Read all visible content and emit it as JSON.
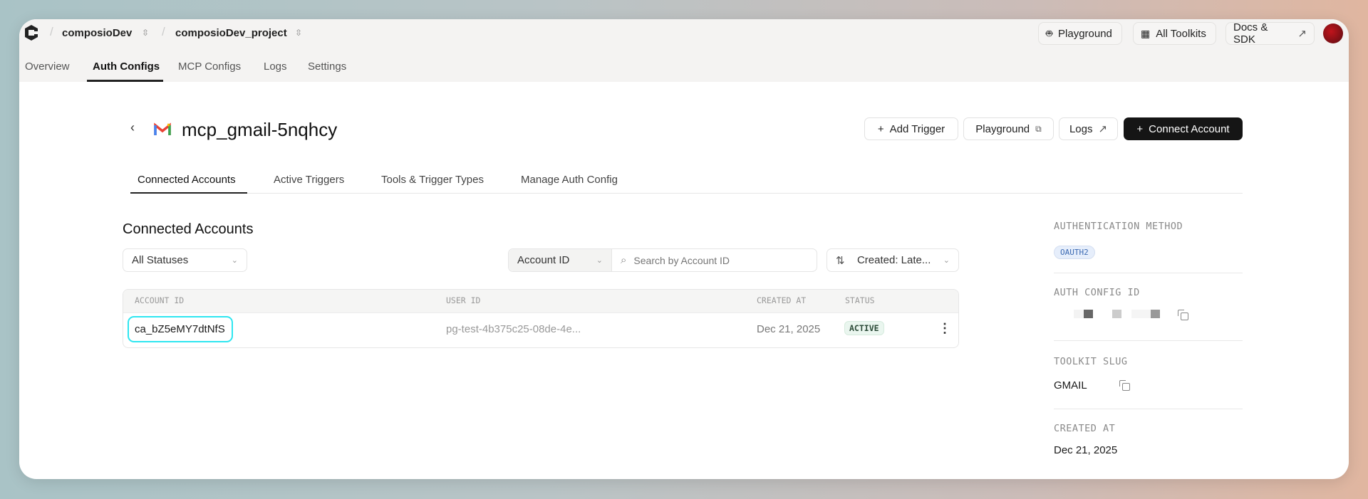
{
  "topbar": {
    "org": "composioDev",
    "project": "composioDev_project",
    "playground": "Playground",
    "all_toolkits": "All Toolkits",
    "docs": "Docs & SDK"
  },
  "nav": {
    "tabs": [
      "Overview",
      "Auth Configs",
      "MCP Configs",
      "Logs",
      "Settings"
    ],
    "active": "Auth Configs"
  },
  "page": {
    "title": "mcp_gmail-5nqhcy",
    "buttons": {
      "add_trigger": "Add Trigger",
      "playground": "Playground",
      "logs": "Logs",
      "connect": "Connect Account"
    }
  },
  "subtabs": {
    "items": [
      "Connected Accounts",
      "Active Triggers",
      "Tools & Trigger Types",
      "Manage Auth Config"
    ],
    "active": "Connected Accounts"
  },
  "section": {
    "title": "Connected Accounts",
    "status_filter": "All Statuses",
    "search_field": "Account ID",
    "search_placeholder": "Search by Account ID",
    "sort": "Created: Late..."
  },
  "table": {
    "columns": [
      "ACCOUNT ID",
      "USER ID",
      "CREATED AT",
      "STATUS"
    ],
    "rows": [
      {
        "account_id": "ca_bZ5eMY7dtNfS",
        "user_id": "pg-test-4b375c25-08de-4e...",
        "created_at": "Dec 21, 2025",
        "status": "ACTIVE"
      }
    ]
  },
  "panel": {
    "auth_method_label": "AUTHENTICATION METHOD",
    "auth_method": "OAUTH2",
    "auth_config_label": "AUTH CONFIG ID",
    "toolkit_label": "TOOLKIT SLUG",
    "toolkit": "GMAIL",
    "created_label": "CREATED AT",
    "created": "Dec 21, 2025"
  },
  "colors": {
    "highlight": "#2ee6f0",
    "active_badge_bg": "#eaf6ef",
    "oauth_badge_bg": "#e6eefb",
    "primary": "#151515"
  }
}
